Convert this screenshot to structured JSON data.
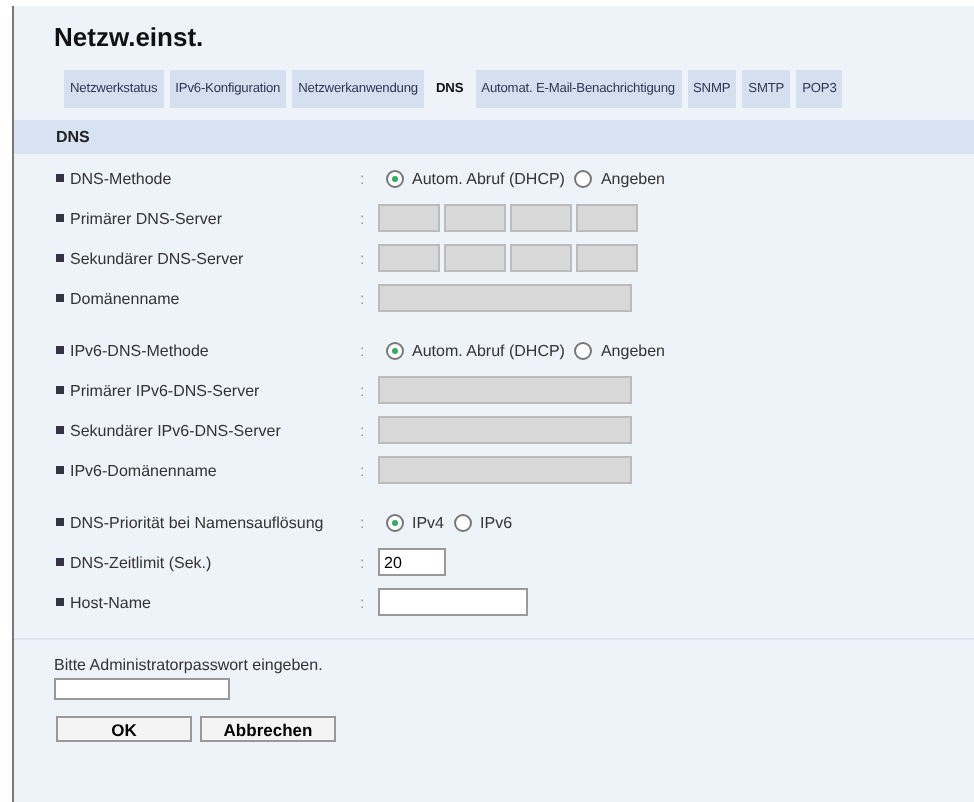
{
  "title": "Netzw.einst.",
  "tabs": [
    {
      "label": "Netzwerkstatus",
      "selected": false
    },
    {
      "label": "IPv6-Konfiguration",
      "selected": false
    },
    {
      "label": "Netzwerkanwendung",
      "selected": false
    },
    {
      "label": "DNS",
      "selected": true
    },
    {
      "label": "Automat. E-Mail-Benachrichtigung",
      "selected": false
    },
    {
      "label": "SNMP",
      "selected": false
    },
    {
      "label": "SMTP",
      "selected": false
    },
    {
      "label": "POP3",
      "selected": false
    }
  ],
  "section": {
    "title": "DNS",
    "groups": [
      [
        {
          "kind": "radio",
          "label": "DNS-Methode",
          "separator": ":",
          "options": [
            {
              "label": "Autom. Abruf (DHCP)",
              "selected": true
            },
            {
              "label": "Angeben",
              "selected": false
            }
          ]
        },
        {
          "kind": "ip",
          "label": "Primärer DNS-Server",
          "separator": ":",
          "disabled": true
        },
        {
          "kind": "ip",
          "label": "Sekundärer DNS-Server",
          "separator": ":",
          "disabled": true
        },
        {
          "kind": "wide",
          "label": "Domänenname",
          "separator": ":",
          "disabled": true
        }
      ],
      [
        {
          "kind": "radio",
          "label": "IPv6-DNS-Methode",
          "separator": ":",
          "options": [
            {
              "label": "Autom. Abruf (DHCP)",
              "selected": true
            },
            {
              "label": "Angeben",
              "selected": false
            }
          ]
        },
        {
          "kind": "wide",
          "label": "Primärer IPv6-DNS-Server",
          "separator": ":",
          "disabled": true
        },
        {
          "kind": "wide",
          "label": "Sekundärer IPv6-DNS-Server",
          "separator": ":",
          "disabled": true
        },
        {
          "kind": "wide",
          "label": "IPv6-Domänenname",
          "separator": ":",
          "disabled": true
        }
      ],
      [
        {
          "kind": "radio",
          "label": "DNS-Priorität bei Namensauflösung",
          "separator": ":",
          "options": [
            {
              "label": "IPv4",
              "selected": true
            },
            {
              "label": "IPv6",
              "selected": false
            }
          ]
        },
        {
          "kind": "short",
          "label": "DNS-Zeitlimit (Sek.)",
          "separator": ":",
          "value": "20"
        },
        {
          "kind": "medium",
          "label": "Host-Name",
          "separator": ":"
        }
      ]
    ]
  },
  "password": {
    "label": "Bitte Administratorpasswort eingeben."
  },
  "buttons": [
    "OK",
    "Abbrechen"
  ]
}
